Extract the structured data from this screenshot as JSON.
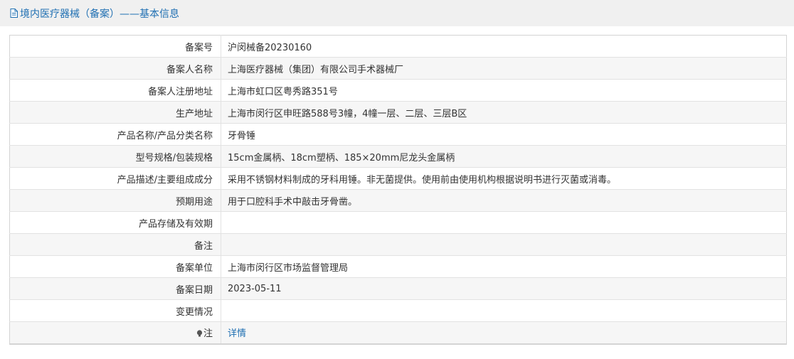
{
  "header": {
    "title": "境内医疗器械（备案）——基本信息",
    "link_color": "#1f6fb2"
  },
  "icons": {
    "header_icon": "document-icon",
    "note_icon": "bulb-icon"
  },
  "rows": [
    {
      "label": "备案号",
      "value": "沪闵械备20230160"
    },
    {
      "label": "备案人名称",
      "value": "上海医疗器械（集团）有限公司手术器械厂"
    },
    {
      "label": "备案人注册地址",
      "value": "上海市虹口区粤秀路351号"
    },
    {
      "label": "生产地址",
      "value": "上海市闵行区申旺路588号3幢，4幢一层、二层、三层B区"
    },
    {
      "label": "产品名称/产品分类名称",
      "value": "牙骨锤"
    },
    {
      "label": "型号规格/包装规格",
      "value": "15cm金属柄、18cm塑柄、185×20mm尼龙头金属柄"
    },
    {
      "label": "产品描述/主要组成成分",
      "value": "采用不锈钢材料制成的牙科用锤。非无菌提供。使用前由使用机构根据说明书进行灭菌或消毒。"
    },
    {
      "label": "预期用途",
      "value": "用于口腔科手术中敲击牙骨凿。"
    },
    {
      "label": "产品存储及有效期",
      "value": ""
    },
    {
      "label": "备注",
      "value": ""
    },
    {
      "label": "备案单位",
      "value": "上海市闵行区市场监督管理局"
    },
    {
      "label": "备案日期",
      "value": "2023-05-11"
    },
    {
      "label": "变更情况",
      "value": ""
    }
  ],
  "note_row": {
    "label": "注",
    "link_text": "详情"
  }
}
